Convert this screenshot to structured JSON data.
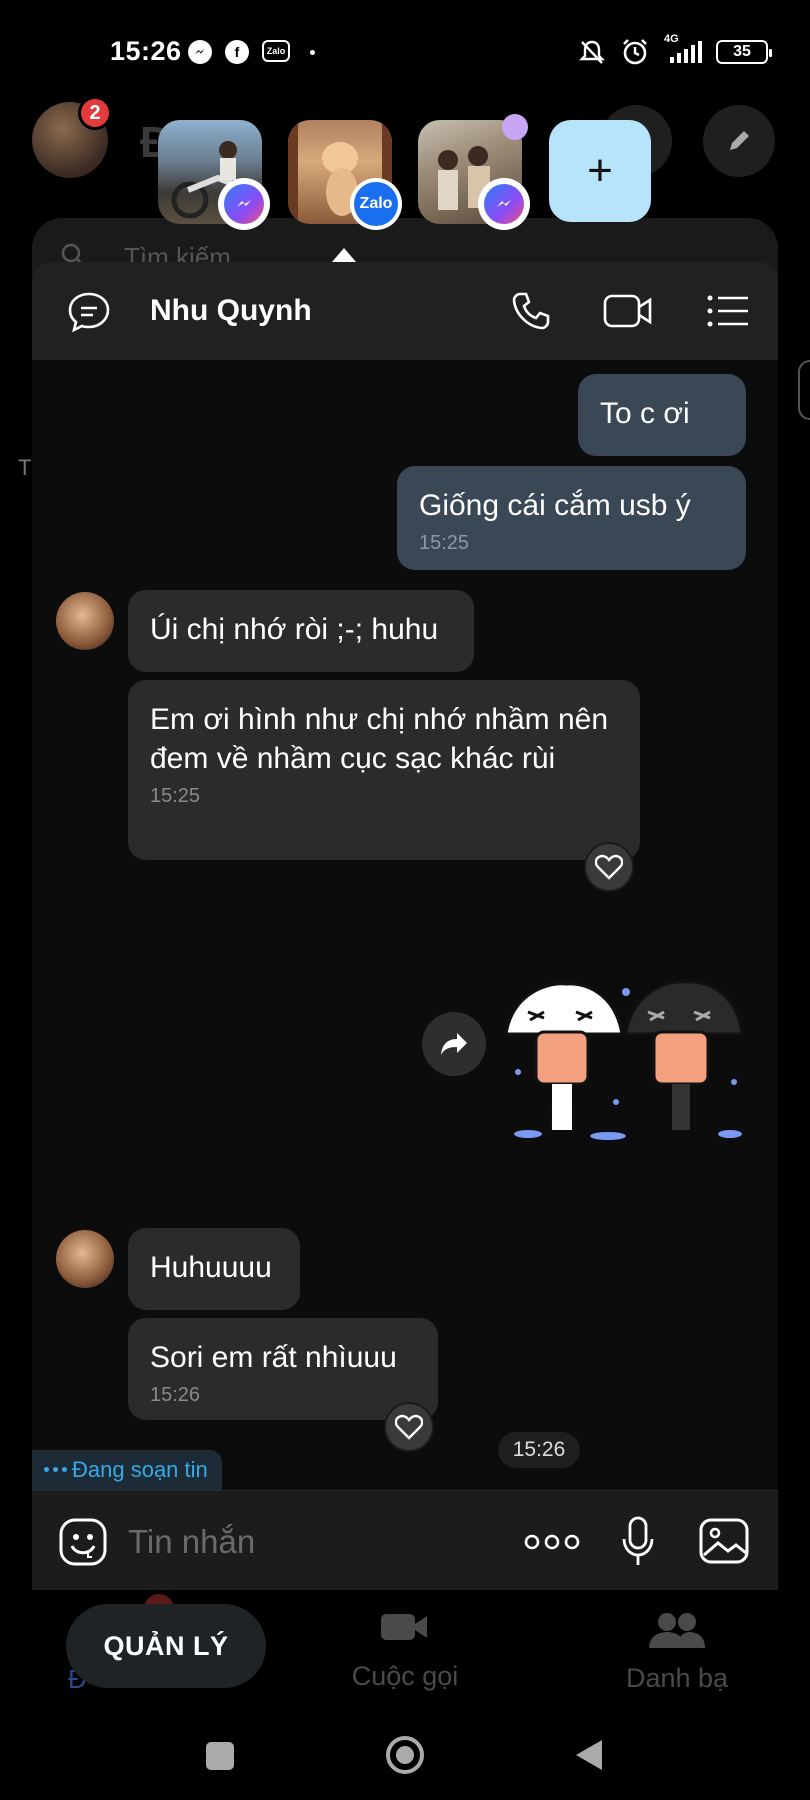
{
  "status_bar": {
    "time": "15:26",
    "network_label": "4G",
    "battery": "35"
  },
  "background_app": {
    "profile_badge": "2",
    "title_partial": "Đ       c",
    "search_placeholder": "Tìm kiếm",
    "left_letter": "T"
  },
  "chat_heads": [
    {
      "name": "messenger-head-1",
      "app_badge": "messenger"
    },
    {
      "name": "zalo-head",
      "app_badge": "Zalo"
    },
    {
      "name": "messenger-head-2",
      "app_badge": "messenger"
    }
  ],
  "add_head_label": "+",
  "chat": {
    "contact_name": "Nhu Quynh",
    "messages": [
      {
        "direction": "out",
        "text": "To c ơi",
        "time": ""
      },
      {
        "direction": "out",
        "text": "Giống cái  cắm usb ý",
        "time": "15:25"
      },
      {
        "direction": "in",
        "text": "Úi chị nhớ ròi ;-; huhu",
        "time": ""
      },
      {
        "direction": "in",
        "text": "Em ơi hình như chị nhớ nhầm nên đem về nhầm cục sạc khác rùi",
        "time": "15:25"
      },
      {
        "direction": "out",
        "text": "[sticker]",
        "time": ""
      },
      {
        "direction": "in",
        "text": "Huhuuuu",
        "time": ""
      },
      {
        "direction": "in",
        "text": "Sori em rất nhìuuu",
        "time": "15:26"
      }
    ],
    "time_separator": "15:26",
    "typing_indicator": "Đang soạn tin",
    "composer_placeholder": "Tin nhắn"
  },
  "bottom_nav": {
    "manage_button": "QUẢN LÝ",
    "calls_label": "Cuộc gọi",
    "contacts_label": "Danh bạ",
    "messages_label_partial": "Đ"
  },
  "colors": {
    "outgoing_bubble": "#3a4754",
    "incoming_bubble": "#2b2b2b",
    "accent_blue": "#37a9e6",
    "add_head_bg": "#b8e4fb"
  }
}
